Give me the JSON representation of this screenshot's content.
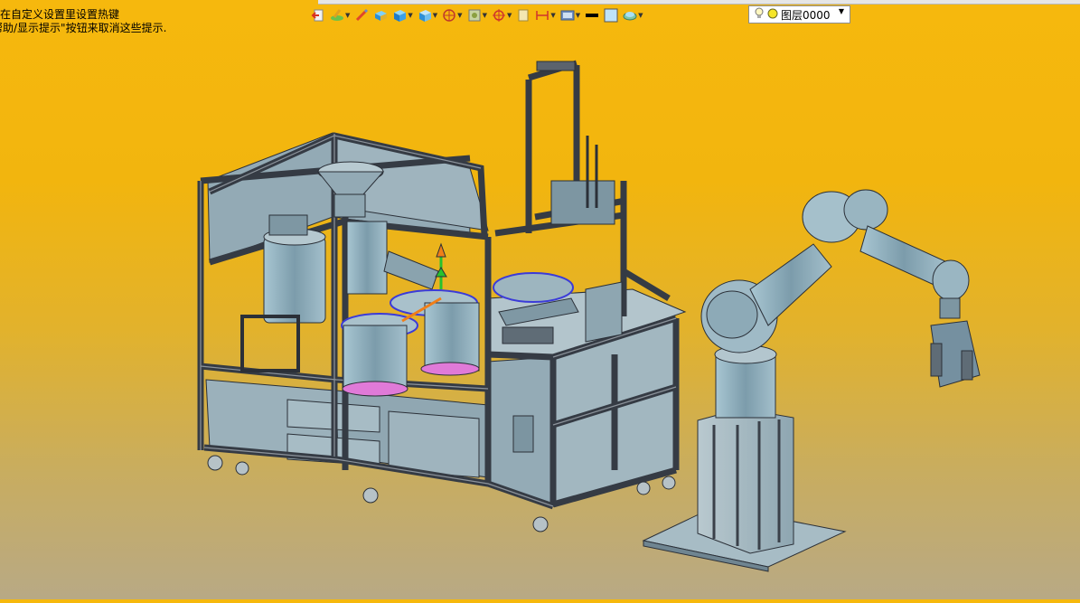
{
  "hint": {
    "line1": "在自定义设置里设置热键",
    "line2": "帮助/显示提示\"按钮来取消这些提示."
  },
  "toolbar": {
    "items": [
      {
        "icon": "exit-sketch-icon"
      },
      {
        "icon": "pen-tool-icon",
        "dropdown": true
      },
      {
        "icon": "edit-pencil-icon"
      },
      {
        "icon": "extrude-box-icon"
      },
      {
        "icon": "solid-box-icon",
        "dropdown": true
      },
      {
        "icon": "shell-box-icon",
        "dropdown": true
      },
      {
        "icon": "section-view-icon",
        "dropdown": true
      },
      {
        "icon": "render-mode-icon",
        "dropdown": true
      },
      {
        "icon": "origin-axes-icon",
        "dropdown": true
      },
      {
        "icon": "page-icon"
      },
      {
        "icon": "dimension-icon",
        "dropdown": true
      },
      {
        "icon": "display-settings-icon",
        "dropdown": true
      },
      {
        "icon": "line-color-swatch"
      },
      {
        "icon": "fill-color-swatch"
      },
      {
        "icon": "layer-surface-icon",
        "dropdown": true
      }
    ],
    "layer_select": {
      "value": "图层0000"
    }
  },
  "colors": {
    "background_top": "#f6b80d",
    "background_bottom": "#b8a985",
    "frame": "#4e5560",
    "metal": "#8fb0bf",
    "accent_pink": "#e07ad8",
    "accent_blue": "#3b3bd8",
    "arrow_green": "#27c22e",
    "arrow_orange": "#f07e18"
  }
}
